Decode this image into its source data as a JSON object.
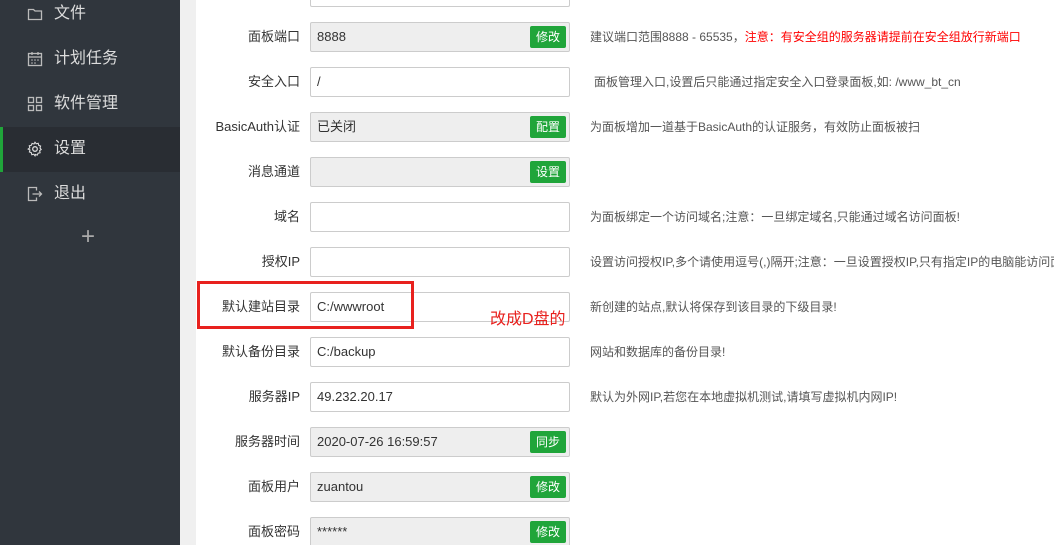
{
  "sidebar": {
    "items": [
      {
        "label": "文件",
        "icon": "folder-icon"
      },
      {
        "label": "计划任务",
        "icon": "calendar-icon"
      },
      {
        "label": "软件管理",
        "icon": "grid-icon"
      },
      {
        "label": "设置",
        "icon": "gear-icon",
        "active": true
      },
      {
        "label": "退出",
        "icon": "logout-icon"
      }
    ],
    "add_label": "+"
  },
  "form": {
    "panel_port": {
      "label": "面板端口",
      "value": "8888",
      "button": "修改",
      "help": "建议端口范围8888 - 65535，",
      "warning": "注意：有安全组的服务器请提前在安全组放行新端口"
    },
    "security_entry": {
      "label": "安全入口",
      "value": "/",
      "help": "面板管理入口,设置后只能通过指定安全入口登录面板,如: /www_bt_cn"
    },
    "basic_auth": {
      "label": "BasicAuth认证",
      "value": "已关闭",
      "button": "配置",
      "help": "为面板增加一道基于BasicAuth的认证服务，有效防止面板被扫"
    },
    "message_channel": {
      "label": "消息通道",
      "value": "",
      "button": "设置"
    },
    "domain": {
      "label": "域名",
      "value": "",
      "help": "为面板绑定一个访问域名;注意：一旦绑定域名,只能通过域名访问面板!"
    },
    "auth_ip": {
      "label": "授权IP",
      "value": "",
      "help": "设置访问授权IP,多个请使用逗号(,)隔开;注意：一旦设置授权IP,只有指定IP的电脑能访问面"
    },
    "site_dir": {
      "label": "默认建站目录",
      "value": "C:/wwwroot",
      "help": "新创建的站点,默认将保存到该目录的下级目录!"
    },
    "backup_dir": {
      "label": "默认备份目录",
      "value": "C:/backup",
      "help": "网站和数据库的备份目录!"
    },
    "server_ip": {
      "label": "服务器IP",
      "value": "49.232.20.17",
      "help": "默认为外网IP,若您在本地虚拟机测试,请填写虚拟机内网IP!"
    },
    "server_time": {
      "label": "服务器时间",
      "value": "2020-07-26 16:59:57",
      "button": "同步"
    },
    "panel_user": {
      "label": "面板用户",
      "value": "zuantou",
      "button": "修改"
    },
    "panel_password": {
      "label": "面板密码",
      "value": "******",
      "button": "修改"
    }
  },
  "annotation": {
    "text": "改成D盘的",
    "color": "#e8211e"
  },
  "colors": {
    "sidebar_bg": "#30363d",
    "accent": "#20a53a",
    "warning": "#ff0000"
  }
}
